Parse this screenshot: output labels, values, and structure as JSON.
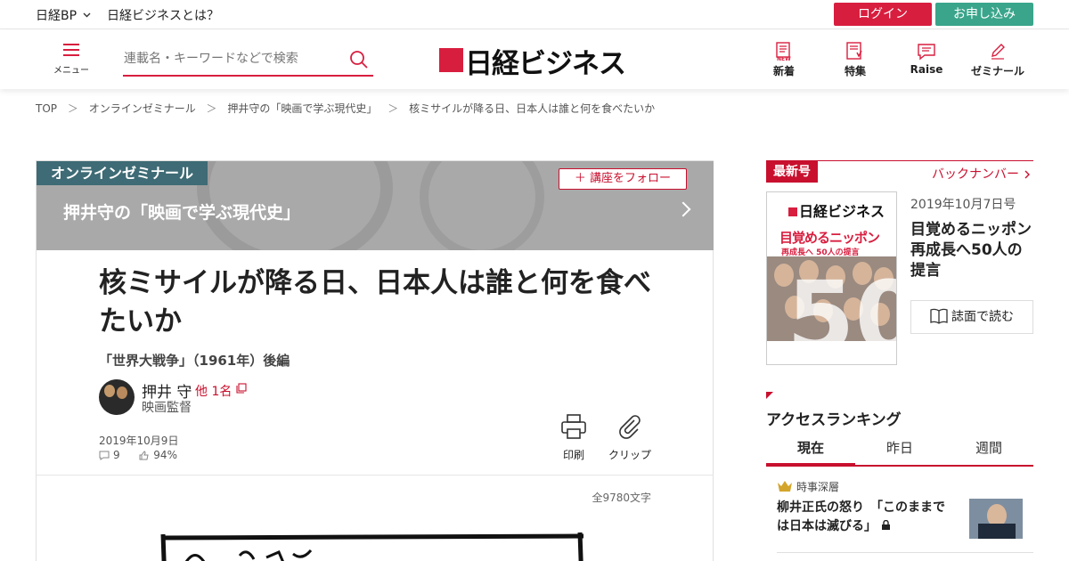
{
  "topbar": {
    "site_link": "日経BP",
    "about_link": "日経ビジネスとは？",
    "login": "ログイン",
    "apply": "お申し込み"
  },
  "header": {
    "menu_label": "メニュー",
    "search_placeholder": "連載名・キーワードなどで検索",
    "logo_text": "日経ビジネス",
    "nav": [
      {
        "label": "新着",
        "icon": "new-icon"
      },
      {
        "label": "特集",
        "icon": "feature-icon"
      },
      {
        "label": "Raise",
        "icon": "raise-icon"
      },
      {
        "label": "ゼミナール",
        "icon": "seminar-icon"
      }
    ],
    "accent": "#d81e3f"
  },
  "breadcrumb": {
    "items": [
      "TOP",
      "オンラインゼミナール",
      "押井守の「映画で学ぶ現代史」",
      "核ミサイルが降る日、日本人は誰と何を食べたいか"
    ],
    "separator": "＞"
  },
  "article": {
    "section_tag": "オンラインゼミナール",
    "series_title": "押井守の「映画で学ぶ現代史」",
    "follow_label": "＋ 講座をフォロー",
    "title": "核ミサイルが降る日、日本人は誰と何を食べたいか",
    "subtitle": "「世界大戦争」（1961年）後編",
    "author": "押井 守",
    "author_more": "他 1名",
    "author_role": "映画監督",
    "date": "2019年10月9日",
    "comments": "9",
    "likes": "94%",
    "print_label": "印刷",
    "clip_label": "クリップ",
    "char_count": "全9780文字"
  },
  "sidebar": {
    "latest_tag": "最新号",
    "backnumber": "バックナンバー",
    "cover_logo": "日経ビジネス",
    "cover_title": "目覚めるニッポン",
    "cover_sub": "再成長へ 50人の提言",
    "cover_number": "50",
    "issue_date": "2019年10月7日号",
    "issue_title": "目覚めるニッポン　再成長へ50人の提言",
    "trial_label": "誌面で読む",
    "ranking_title": "アクセスランキング",
    "ranking_tabs": [
      "現在",
      "昨日",
      "週間"
    ],
    "ranking_item": {
      "category": "時事深層",
      "headline": "柳井正氏の怒り　「このままでは日本は滅びる」"
    }
  }
}
